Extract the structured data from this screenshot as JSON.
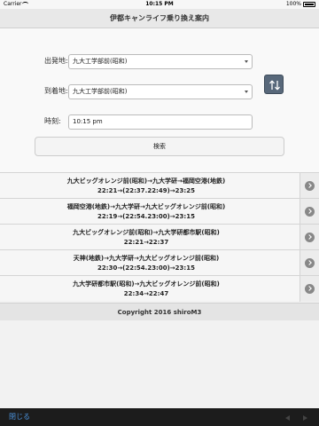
{
  "status_bar": {
    "carrier": "Carrier",
    "time": "10:15 PM",
    "battery": "100%"
  },
  "header": {
    "title": "伊都キャンライフ乗り換え案内"
  },
  "form": {
    "departure_label": "出発地:",
    "departure_value": "九大工学部前(昭和)",
    "arrival_label": "到着地:",
    "arrival_value": "九大工学部前(昭和)",
    "time_label": "時刻:",
    "time_value": "10:15 pm",
    "search_label": "検索"
  },
  "results": [
    {
      "route": "九大ビッグオレンジ前(昭和)→九大学研→福岡空港(地鉄)",
      "times": "22:21→(22:37.22:49)→23:25"
    },
    {
      "route": "福岡空港(地鉄)→九大学研→九大ビッグオレンジ前(昭和)",
      "times": "22:19→(22:54.23:00)→23:15"
    },
    {
      "route": "九大ビッグオレンジ前(昭和)→九大学研都市駅(昭和)",
      "times": "22:21→22:37"
    },
    {
      "route": "天神(地鉄)→九大学研→九大ビッグオレンジ前(昭和)",
      "times": "22:30→(22:54.23:00)→23:15"
    },
    {
      "route": "九大学研都市駅(昭和)→九大ビッグオレンジ前(昭和)",
      "times": "22:34→22:47"
    }
  ],
  "footer": {
    "copyright": "Copyright 2016 shiroM3"
  },
  "bottom_bar": {
    "close_label": "閉じる"
  }
}
